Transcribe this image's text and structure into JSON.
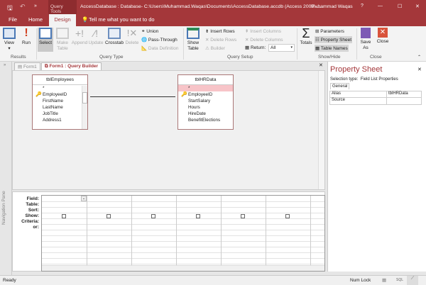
{
  "titlebar": {
    "context": "Query Tools",
    "title": "AccessDatabase : Database- C:\\Users\\Muhammad.Waqas\\Documents\\AccessDatabase.accdb (Access 2007 -...",
    "user": "Muhammad Waqas",
    "help": "?",
    "minimize": "—",
    "maximize": "☐",
    "close": "✕"
  },
  "tabs": {
    "file": "File",
    "home": "Home",
    "design": "Design",
    "tellme": "Tell me what you want to do"
  },
  "ribbon": {
    "results": {
      "label": "Results",
      "view": "View",
      "run": "Run"
    },
    "query_type": {
      "label": "Query Type",
      "select": "Select",
      "make_table": "Make Table",
      "append": "Append",
      "update": "Update",
      "crosstab": "Crosstab",
      "delete": "Delete",
      "union": "Union",
      "pass_through": "Pass-Through",
      "data_definition": "Data Definition"
    },
    "query_setup": {
      "label": "Query Setup",
      "show_table": "Show Table",
      "insert_rows": "Insert Rows",
      "delete_rows": "Delete Rows",
      "builder": "Builder",
      "insert_columns": "Insert Columns",
      "delete_columns": "Delete Columns",
      "return_label": "Return:",
      "return_value": "All"
    },
    "show_hide": {
      "label": "Show/Hide",
      "totals": "Totals",
      "parameters": "Parameters",
      "property_sheet": "Property Sheet",
      "table_names": "Table Names"
    },
    "close": {
      "label": "Close",
      "save_as": "Save As",
      "close": "Close"
    }
  },
  "nav_pane": {
    "label": "Navigation Pane"
  },
  "doc_tabs": [
    {
      "label": "Form1"
    },
    {
      "label": "Form1 : Query Builder"
    }
  ],
  "tables": [
    {
      "name": "tblEmployees",
      "fields": [
        "*",
        "EmployeeID",
        "FirstName",
        "LastName",
        "JobTitle",
        "Address1"
      ]
    },
    {
      "name": "tblHRData",
      "fields": [
        "*",
        "EmployeeID",
        "StartSalary",
        "Hours",
        "HireDate",
        "BenefitElections"
      ]
    }
  ],
  "grid": {
    "rows": [
      "Field:",
      "Table:",
      "Sort:",
      "Show:",
      "Criteria:",
      "or:"
    ]
  },
  "property_sheet": {
    "title": "Property Sheet",
    "selection_label": "Selection type:",
    "selection_type": "Field List Properties",
    "tab": "General",
    "rows": [
      {
        "name": "Alias",
        "value": "tblHRData"
      },
      {
        "name": "Source",
        "value": ""
      }
    ]
  },
  "status": {
    "left": "Ready",
    "num_lock": "Num Lock"
  },
  "colors": {
    "accent": "#a4373a"
  }
}
